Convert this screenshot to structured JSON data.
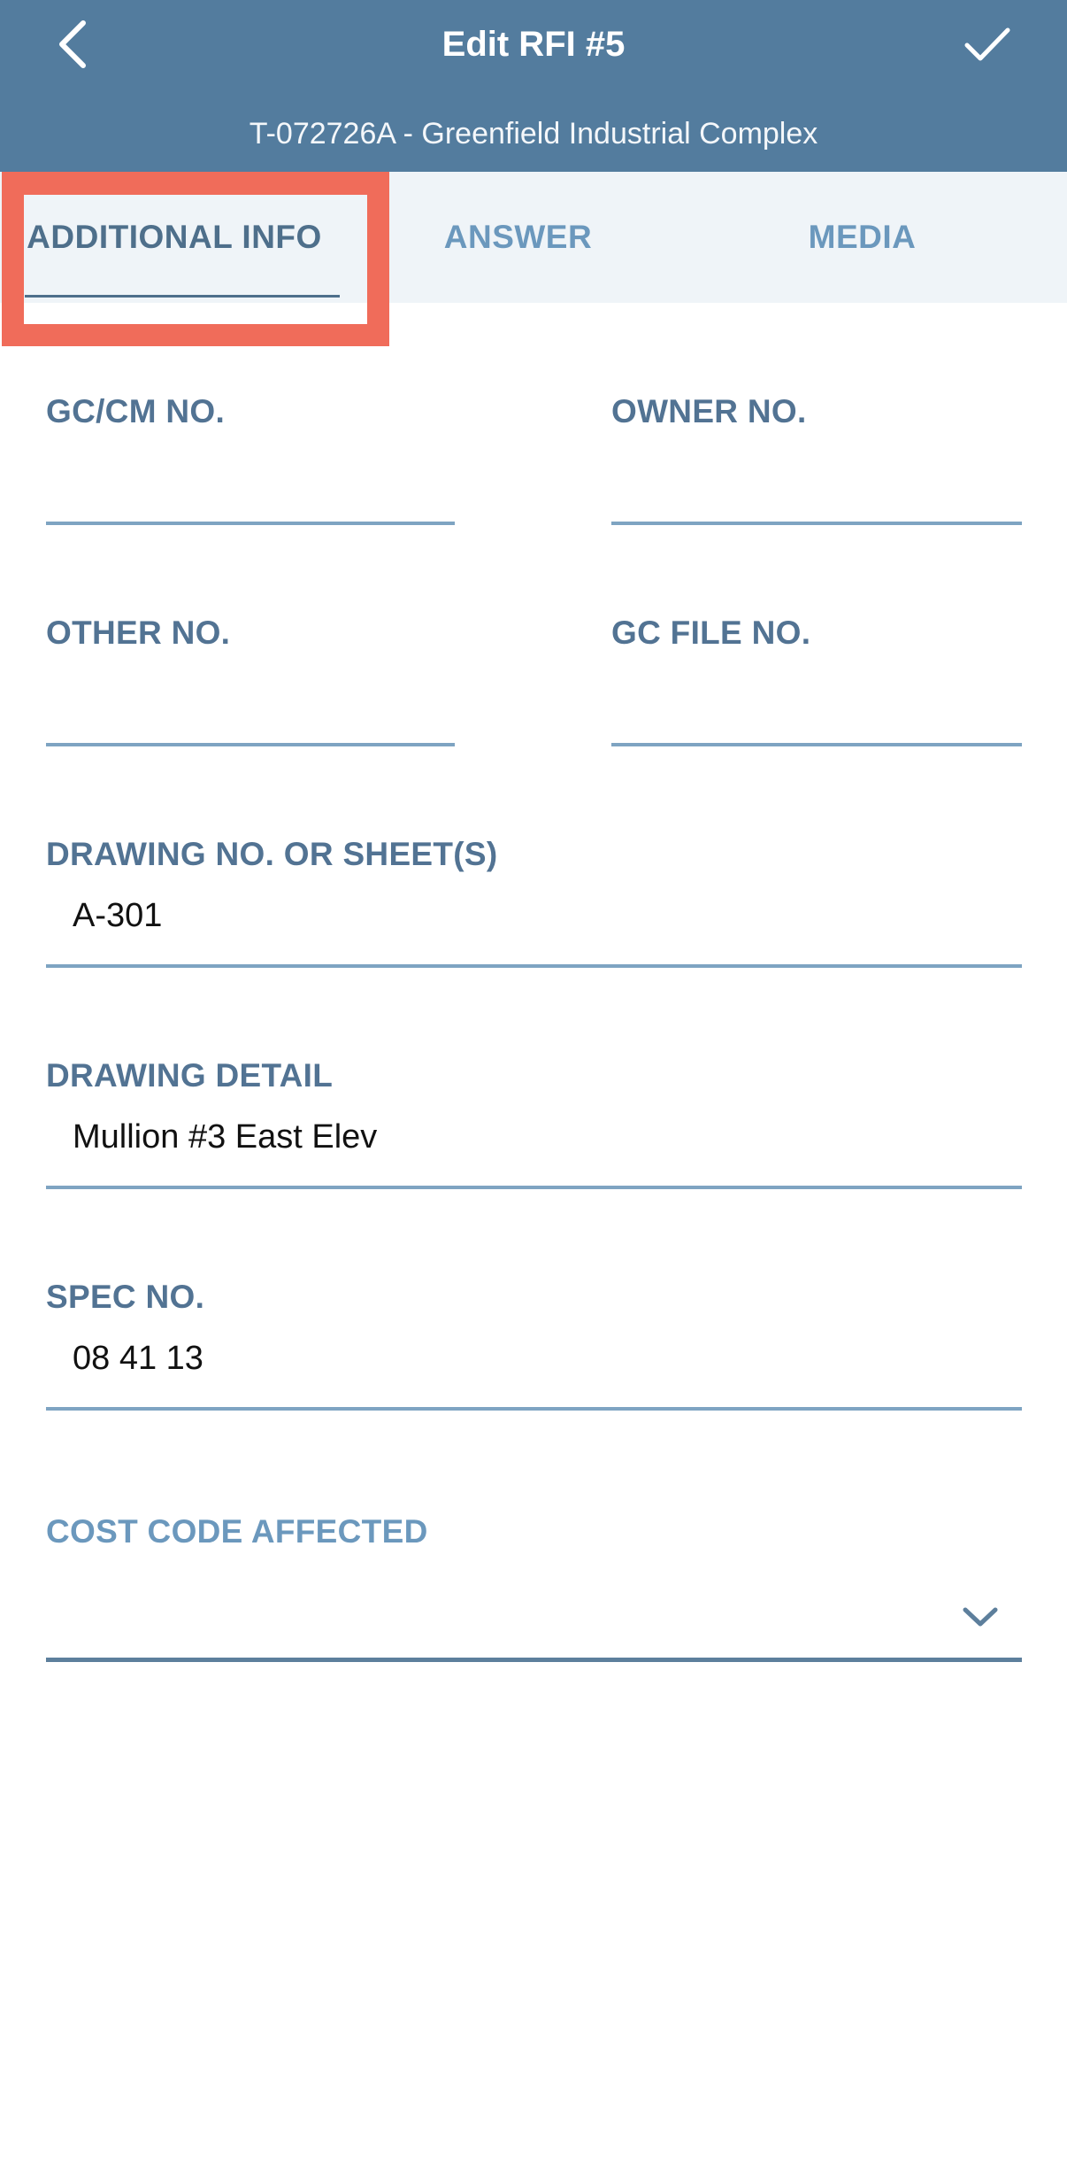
{
  "header": {
    "title": "Edit RFI #5",
    "subtitle": "T-072726A - Greenfield Industrial Complex",
    "back_icon": "chevron-left-icon",
    "confirm_icon": "checkmark-icon"
  },
  "tabs": [
    {
      "label": "ADDITIONAL INFO",
      "active": true
    },
    {
      "label": "ANSWER",
      "active": false
    },
    {
      "label": "MEDIA",
      "active": false
    }
  ],
  "fields": {
    "gc_cm_no": {
      "label": "GC/CM NO.",
      "value": ""
    },
    "owner_no": {
      "label": "OWNER NO.",
      "value": ""
    },
    "other_no": {
      "label": "OTHER NO.",
      "value": ""
    },
    "gc_file_no": {
      "label": "GC FILE NO.",
      "value": ""
    },
    "drawing_no": {
      "label": "DRAWING NO. OR SHEET(S)",
      "value": "A-301"
    },
    "drawing_detail": {
      "label": "DRAWING DETAIL",
      "value": "Mullion #3 East Elev"
    },
    "spec_no": {
      "label": "SPEC NO.",
      "value": "08 41 13"
    },
    "cost_code": {
      "label": "COST CODE AFFECTED",
      "value": ""
    }
  },
  "colors": {
    "header_bg": "#537c9e",
    "tab_bg": "#eff4f8",
    "highlight": "#f06c5a",
    "label": "#527393"
  }
}
